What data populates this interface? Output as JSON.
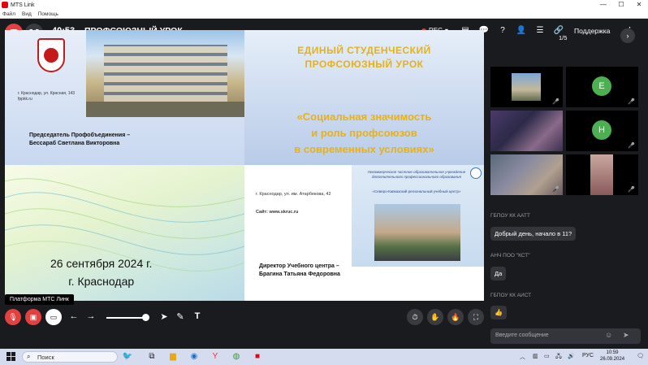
{
  "window": {
    "app_name": "MTS Link",
    "menu": [
      "Файл",
      "Вид",
      "Помощь"
    ],
    "controls": [
      "—",
      "☐",
      "✕"
    ]
  },
  "topbar": {
    "timer": "40:53",
    "title": "ПРОФСОЮЗНЫЙ УРОК",
    "rec_label": "REC",
    "support_label": "Поддержка"
  },
  "slide": {
    "addr1": "г. Краснодар, ул. Красная, 143",
    "site1": "fppkk.ru",
    "chair_role": "Председатель Профобъединения –",
    "chair_name": "Бессараб Светлана Викторовна",
    "headline1": "ЕДИНЫЙ   СТУДЕНЧЕСКИЙ",
    "headline2": "ПРОФСОЮЗНЫЙ    УРОК",
    "topic1": "«Социальная значимость",
    "topic2": "и роль профсоюзов",
    "topic3": "в современных условиях»",
    "date1": "26 сентября 2024 г.",
    "date2": "г. Краснодар",
    "addr2": "г. Краснодар, ул. им. Атарбекова, 42",
    "site2": "Сайт: www.skruc.ru",
    "panel_head": "Некоммерческое частное образовательное учреждение дополнительного профессионального образования",
    "panel_sub": "«Северо-Кавказский региональный учебный центр»",
    "director_role": "Директор Учебного центра –",
    "director_name": "Брагина Татьяна Федоровна"
  },
  "tooltip": "Платформа МТС Линк",
  "pager": "1/5",
  "tiles": [
    {
      "type": "photo"
    },
    {
      "type": "avatar",
      "letter": "E"
    },
    {
      "type": "photo"
    },
    {
      "type": "avatar",
      "letter": "H"
    },
    {
      "type": "photo"
    },
    {
      "type": "photo"
    }
  ],
  "chat": [
    {
      "author": "ГБПОУ КК ААТТ",
      "text": "Добрый день, начало в 11?"
    },
    {
      "author": "АНЧ ПОО \"КСТ\"",
      "text": "Да"
    },
    {
      "author": "ГБПОУ КК АИСТ",
      "text": "👍"
    }
  ],
  "chat_input": {
    "placeholder": "Введите сообщение"
  },
  "taskbar": {
    "search_label": "Поиск",
    "lang": "РУС",
    "time": "10:59",
    "date": "26.09.2024"
  },
  "colors": {
    "accent_red": "#e34040",
    "bg": "#1a1b1f",
    "gold": "#e7b218"
  }
}
